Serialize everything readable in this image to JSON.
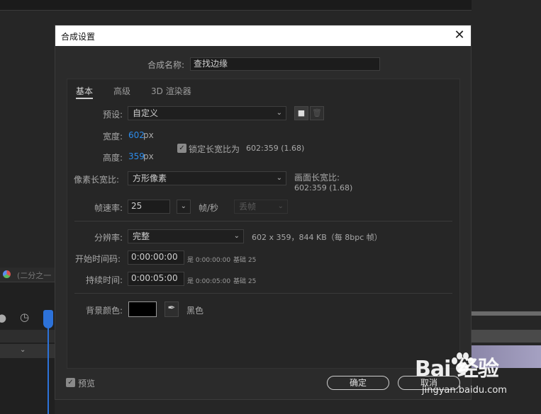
{
  "background": {
    "comp_tab": "(二分之一",
    "watermark_logo": "Bai  经验",
    "watermark_url": "jingyan.baidu.com"
  },
  "dialog": {
    "title": "合成设置",
    "close_icon": "close-icon",
    "comp_name_label": "合成名称:",
    "comp_name_value": "查找边缘",
    "tabs": [
      "基本",
      "高级",
      "3D 渲染器"
    ],
    "preset_label": "预设:",
    "preset_value": "自定义",
    "width_label": "宽度:",
    "width_value": "602",
    "width_unit": "px",
    "height_label": "高度:",
    "height_value": "359",
    "height_unit": "px",
    "lock_label": "锁定长宽比为",
    "lock_ratio": "602:359 (1.68)",
    "lock_checked": true,
    "pixel_aspect_label": "像素长宽比:",
    "pixel_aspect_value": "方形像素",
    "frame_aspect_label": "画面长宽比:",
    "frame_aspect_value": "602:359 (1.68)",
    "frame_rate_label": "帧速率:",
    "frame_rate_value": "25",
    "frame_rate_unit": "帧/秒",
    "drop_frame_value": "丢帧",
    "resolution_label": "分辨率:",
    "resolution_value": "完整",
    "resolution_info": "602 x 359，844 KB（每 8bpc 帧）",
    "start_tc_label": "开始时间码:",
    "start_tc_value": "0:00:00:00",
    "start_tc_note": "是 0:00:00:00",
    "start_tc_base": "基础 25",
    "duration_label": "持续时间:",
    "duration_value": "0:00:05:00",
    "duration_note": "是 0:00:05:00",
    "duration_base": "基础 25",
    "bg_color_label": "背景颜色:",
    "bg_color_hex": "#000000",
    "bg_color_name": "黑色",
    "preview_label": "预览",
    "preview_checked": true,
    "ok_label": "确定",
    "cancel_label": "取消"
  },
  "colors": {
    "accent_blue": "#2d8ceb",
    "playhead": "#2d72d9"
  }
}
